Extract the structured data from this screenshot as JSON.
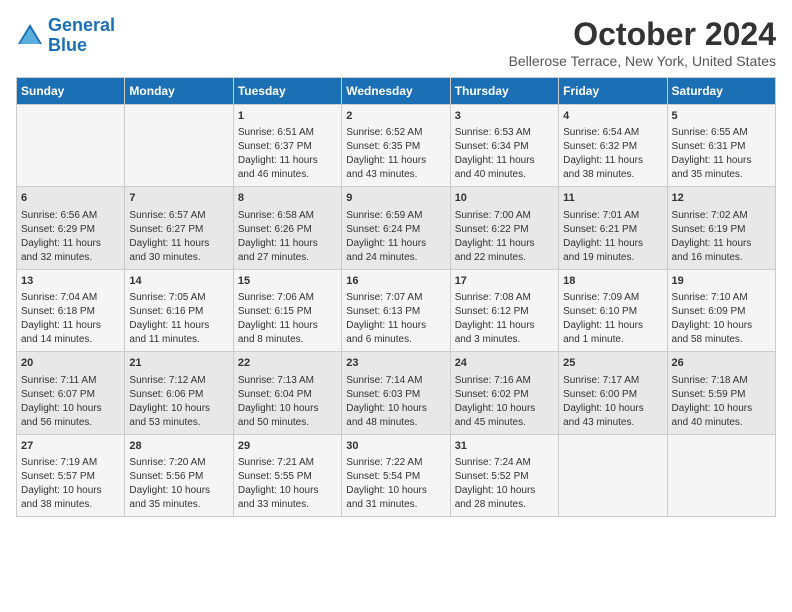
{
  "header": {
    "logo_line1": "General",
    "logo_line2": "Blue",
    "month_title": "October 2024",
    "subtitle": "Bellerose Terrace, New York, United States"
  },
  "weekdays": [
    "Sunday",
    "Monday",
    "Tuesday",
    "Wednesday",
    "Thursday",
    "Friday",
    "Saturday"
  ],
  "weeks": [
    [
      {
        "day": "",
        "lines": []
      },
      {
        "day": "",
        "lines": []
      },
      {
        "day": "1",
        "lines": [
          "Sunrise: 6:51 AM",
          "Sunset: 6:37 PM",
          "Daylight: 11 hours",
          "and 46 minutes."
        ]
      },
      {
        "day": "2",
        "lines": [
          "Sunrise: 6:52 AM",
          "Sunset: 6:35 PM",
          "Daylight: 11 hours",
          "and 43 minutes."
        ]
      },
      {
        "day": "3",
        "lines": [
          "Sunrise: 6:53 AM",
          "Sunset: 6:34 PM",
          "Daylight: 11 hours",
          "and 40 minutes."
        ]
      },
      {
        "day": "4",
        "lines": [
          "Sunrise: 6:54 AM",
          "Sunset: 6:32 PM",
          "Daylight: 11 hours",
          "and 38 minutes."
        ]
      },
      {
        "day": "5",
        "lines": [
          "Sunrise: 6:55 AM",
          "Sunset: 6:31 PM",
          "Daylight: 11 hours",
          "and 35 minutes."
        ]
      }
    ],
    [
      {
        "day": "6",
        "lines": [
          "Sunrise: 6:56 AM",
          "Sunset: 6:29 PM",
          "Daylight: 11 hours",
          "and 32 minutes."
        ]
      },
      {
        "day": "7",
        "lines": [
          "Sunrise: 6:57 AM",
          "Sunset: 6:27 PM",
          "Daylight: 11 hours",
          "and 30 minutes."
        ]
      },
      {
        "day": "8",
        "lines": [
          "Sunrise: 6:58 AM",
          "Sunset: 6:26 PM",
          "Daylight: 11 hours",
          "and 27 minutes."
        ]
      },
      {
        "day": "9",
        "lines": [
          "Sunrise: 6:59 AM",
          "Sunset: 6:24 PM",
          "Daylight: 11 hours",
          "and 24 minutes."
        ]
      },
      {
        "day": "10",
        "lines": [
          "Sunrise: 7:00 AM",
          "Sunset: 6:22 PM",
          "Daylight: 11 hours",
          "and 22 minutes."
        ]
      },
      {
        "day": "11",
        "lines": [
          "Sunrise: 7:01 AM",
          "Sunset: 6:21 PM",
          "Daylight: 11 hours",
          "and 19 minutes."
        ]
      },
      {
        "day": "12",
        "lines": [
          "Sunrise: 7:02 AM",
          "Sunset: 6:19 PM",
          "Daylight: 11 hours",
          "and 16 minutes."
        ]
      }
    ],
    [
      {
        "day": "13",
        "lines": [
          "Sunrise: 7:04 AM",
          "Sunset: 6:18 PM",
          "Daylight: 11 hours",
          "and 14 minutes."
        ]
      },
      {
        "day": "14",
        "lines": [
          "Sunrise: 7:05 AM",
          "Sunset: 6:16 PM",
          "Daylight: 11 hours",
          "and 11 minutes."
        ]
      },
      {
        "day": "15",
        "lines": [
          "Sunrise: 7:06 AM",
          "Sunset: 6:15 PM",
          "Daylight: 11 hours",
          "and 8 minutes."
        ]
      },
      {
        "day": "16",
        "lines": [
          "Sunrise: 7:07 AM",
          "Sunset: 6:13 PM",
          "Daylight: 11 hours",
          "and 6 minutes."
        ]
      },
      {
        "day": "17",
        "lines": [
          "Sunrise: 7:08 AM",
          "Sunset: 6:12 PM",
          "Daylight: 11 hours",
          "and 3 minutes."
        ]
      },
      {
        "day": "18",
        "lines": [
          "Sunrise: 7:09 AM",
          "Sunset: 6:10 PM",
          "Daylight: 11 hours",
          "and 1 minute."
        ]
      },
      {
        "day": "19",
        "lines": [
          "Sunrise: 7:10 AM",
          "Sunset: 6:09 PM",
          "Daylight: 10 hours",
          "and 58 minutes."
        ]
      }
    ],
    [
      {
        "day": "20",
        "lines": [
          "Sunrise: 7:11 AM",
          "Sunset: 6:07 PM",
          "Daylight: 10 hours",
          "and 56 minutes."
        ]
      },
      {
        "day": "21",
        "lines": [
          "Sunrise: 7:12 AM",
          "Sunset: 6:06 PM",
          "Daylight: 10 hours",
          "and 53 minutes."
        ]
      },
      {
        "day": "22",
        "lines": [
          "Sunrise: 7:13 AM",
          "Sunset: 6:04 PM",
          "Daylight: 10 hours",
          "and 50 minutes."
        ]
      },
      {
        "day": "23",
        "lines": [
          "Sunrise: 7:14 AM",
          "Sunset: 6:03 PM",
          "Daylight: 10 hours",
          "and 48 minutes."
        ]
      },
      {
        "day": "24",
        "lines": [
          "Sunrise: 7:16 AM",
          "Sunset: 6:02 PM",
          "Daylight: 10 hours",
          "and 45 minutes."
        ]
      },
      {
        "day": "25",
        "lines": [
          "Sunrise: 7:17 AM",
          "Sunset: 6:00 PM",
          "Daylight: 10 hours",
          "and 43 minutes."
        ]
      },
      {
        "day": "26",
        "lines": [
          "Sunrise: 7:18 AM",
          "Sunset: 5:59 PM",
          "Daylight: 10 hours",
          "and 40 minutes."
        ]
      }
    ],
    [
      {
        "day": "27",
        "lines": [
          "Sunrise: 7:19 AM",
          "Sunset: 5:57 PM",
          "Daylight: 10 hours",
          "and 38 minutes."
        ]
      },
      {
        "day": "28",
        "lines": [
          "Sunrise: 7:20 AM",
          "Sunset: 5:56 PM",
          "Daylight: 10 hours",
          "and 35 minutes."
        ]
      },
      {
        "day": "29",
        "lines": [
          "Sunrise: 7:21 AM",
          "Sunset: 5:55 PM",
          "Daylight: 10 hours",
          "and 33 minutes."
        ]
      },
      {
        "day": "30",
        "lines": [
          "Sunrise: 7:22 AM",
          "Sunset: 5:54 PM",
          "Daylight: 10 hours",
          "and 31 minutes."
        ]
      },
      {
        "day": "31",
        "lines": [
          "Sunrise: 7:24 AM",
          "Sunset: 5:52 PM",
          "Daylight: 10 hours",
          "and 28 minutes."
        ]
      },
      {
        "day": "",
        "lines": []
      },
      {
        "day": "",
        "lines": []
      }
    ]
  ]
}
